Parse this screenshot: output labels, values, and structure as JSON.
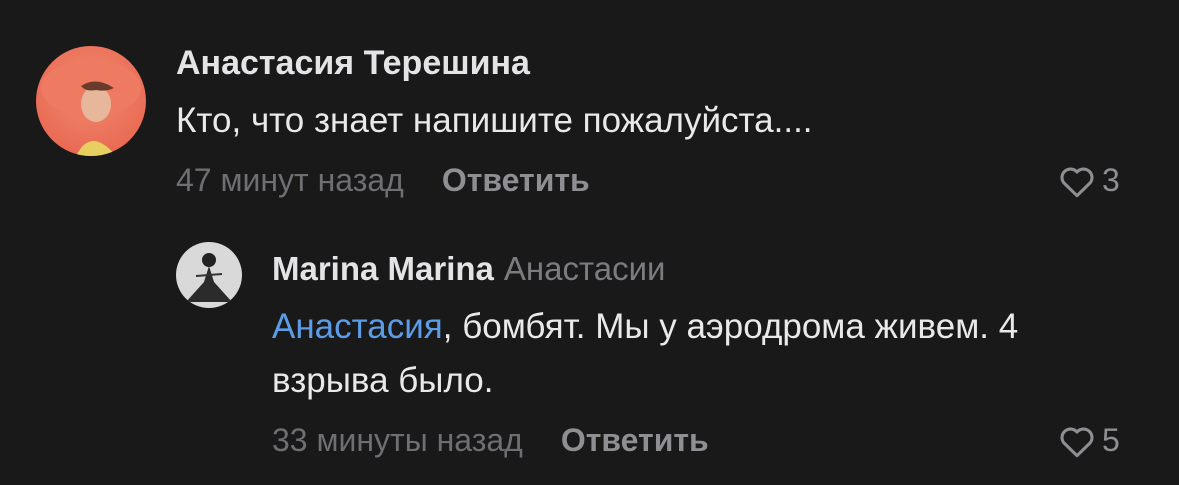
{
  "comments": [
    {
      "author": "Анастасия Терешина",
      "text": "Кто, что знает напишите пожалуйста....",
      "time": "47 минут назад",
      "reply_label": "Ответить",
      "likes": "3"
    },
    {
      "author": "Marina Marina",
      "reply_to": "Анастасии",
      "mention": "Анастасия",
      "text": ", бомбят. Мы у аэродрома живем. 4 взрыва было.",
      "time": "33 минуты назад",
      "reply_label": "Ответить",
      "likes": "5"
    }
  ],
  "colors": {
    "background": "#19191a",
    "mention": "#5c9ce6",
    "muted": "#6e6e73"
  }
}
